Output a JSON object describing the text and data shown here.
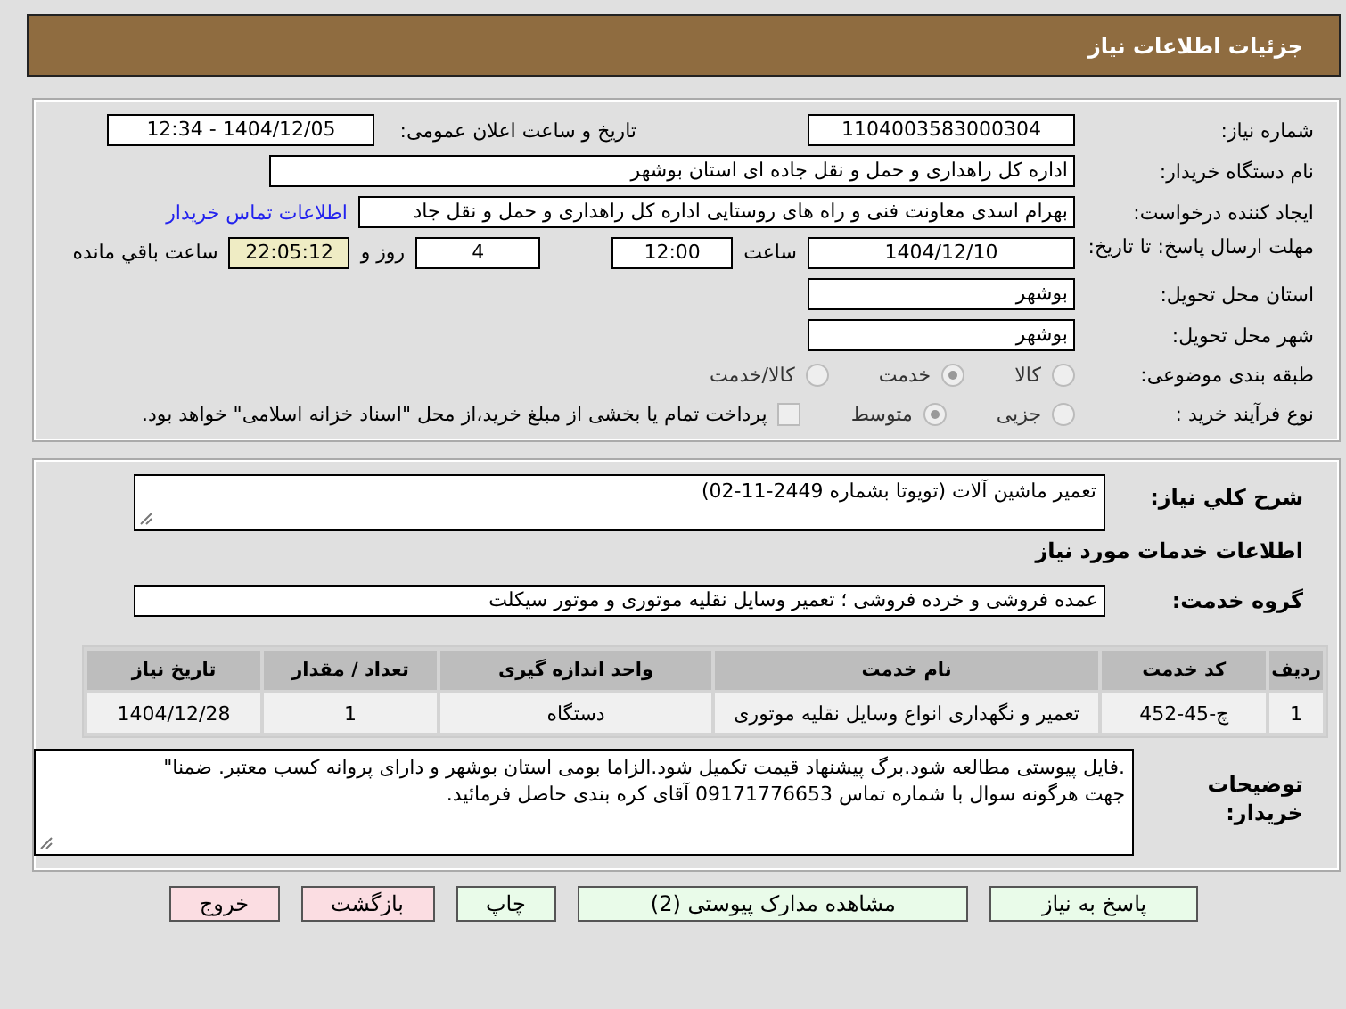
{
  "header": {
    "title": "جزئیات اطلاعات نیاز"
  },
  "details": {
    "need_number": {
      "label": "شماره نیاز:",
      "value": "1104003583000304"
    },
    "announce": {
      "label": "تاریخ و ساعت اعلان عمومی:",
      "value": "1404/12/05 - 12:34"
    },
    "buyer": {
      "label": "نام دستگاه خریدار:",
      "value": "اداره کل راهداری و حمل و نقل جاده ای استان بوشهر"
    },
    "requester": {
      "label": "ایجاد کننده درخواست:",
      "value": "بهرام اسدی معاونت فنی و راه های روستایی اداره کل راهداری و حمل و نقل جاد",
      "link": "اطلاعات تماس خریدار"
    },
    "deadline": {
      "label": "مهلت ارسال پاسخ: تا تاریخ:",
      "date": "1404/12/10",
      "time_label": "ساعت",
      "time": "12:00",
      "days": "4",
      "days_label": "روز و",
      "remaining": "22:05:12",
      "remaining_label": "ساعت باقي مانده"
    },
    "province": {
      "label": "استان محل تحویل:",
      "value": "بوشهر"
    },
    "city": {
      "label": "شهر محل تحویل:",
      "value": "بوشهر"
    },
    "category": {
      "label": "طبقه بندی موضوعی:",
      "options": [
        {
          "label": "کالا",
          "selected": false
        },
        {
          "label": "خدمت",
          "selected": true
        },
        {
          "label": "کالا/خدمت",
          "selected": false
        }
      ]
    },
    "process": {
      "label": "نوع فرآیند خرید :",
      "options": [
        {
          "label": "جزیی",
          "selected": false
        },
        {
          "label": "متوسط",
          "selected": true
        }
      ],
      "payment": {
        "checked": false,
        "text": "پرداخت تمام یا بخشی از مبلغ خرید،از محل \"اسناد خزانه اسلامی\" خواهد بود."
      }
    }
  },
  "services": {
    "description": {
      "label": "شرح کلي نیاز:",
      "value": "تعمیر ماشین آلات  (تویوتا بشماره 2449-11-02)"
    },
    "heading": "اطلاعات خدمات مورد نیاز",
    "group": {
      "label": "گروه خدمت:",
      "value": "عمده فروشی و خرده فروشی ؛ تعمیر وسایل نقلیه موتوری و موتور سیکلت"
    },
    "table": {
      "columns": [
        "ردیف",
        "کد خدمت",
        "نام خدمت",
        "واحد اندازه گیری",
        "تعداد / مقدار",
        "تاریخ نیاز"
      ],
      "rows": [
        [
          "1",
          "چ-45-452",
          "تعمیر و نگهداری انواع وسایل نقلیه موتوری",
          "دستگاه",
          "1",
          "1404/12/28"
        ]
      ]
    },
    "notes": {
      "label": "توضیحات خریدار:",
      "lines": [
        ".فایل پیوستی مطالعه شود.برگ پیشنهاد قیمت تکمیل شود.الزاما بومی استان بوشهر و دارای پروانه کسب معتبر. ضمنا\"",
        "جهت هرگونه سوال با شماره تماس 09171776653 آقای کره بندی حاصل فرمائید."
      ]
    }
  },
  "buttons": [
    {
      "label": "پاسخ به نیاز",
      "kind": "action"
    },
    {
      "label": "مشاهده مدارک پیوستی (2)",
      "kind": "action"
    },
    {
      "label": "چاپ",
      "kind": "action"
    },
    {
      "label": "بازگشت",
      "kind": "exit"
    },
    {
      "label": "خروج",
      "kind": "exit"
    }
  ]
}
